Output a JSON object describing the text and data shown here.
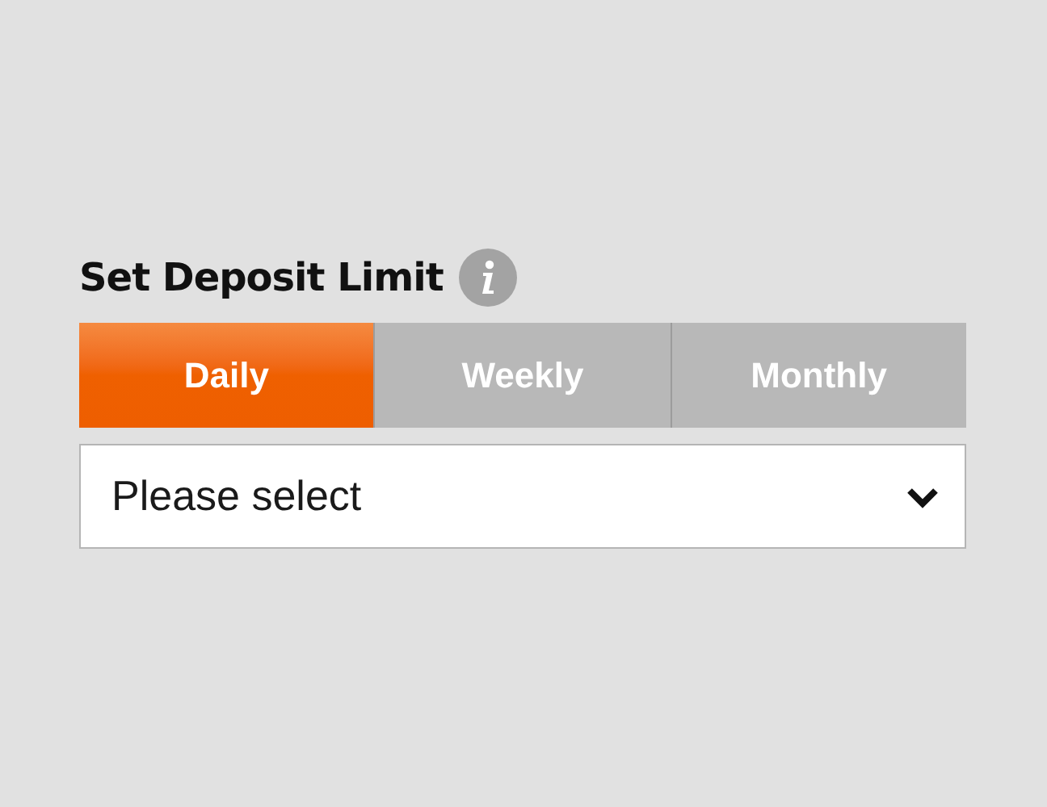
{
  "title": "Set Deposit Limit",
  "tabs": [
    {
      "label": "Daily",
      "selected": true
    },
    {
      "label": "Weekly",
      "selected": false
    },
    {
      "label": "Monthly",
      "selected": false
    }
  ],
  "select": {
    "placeholder": "Please select"
  }
}
